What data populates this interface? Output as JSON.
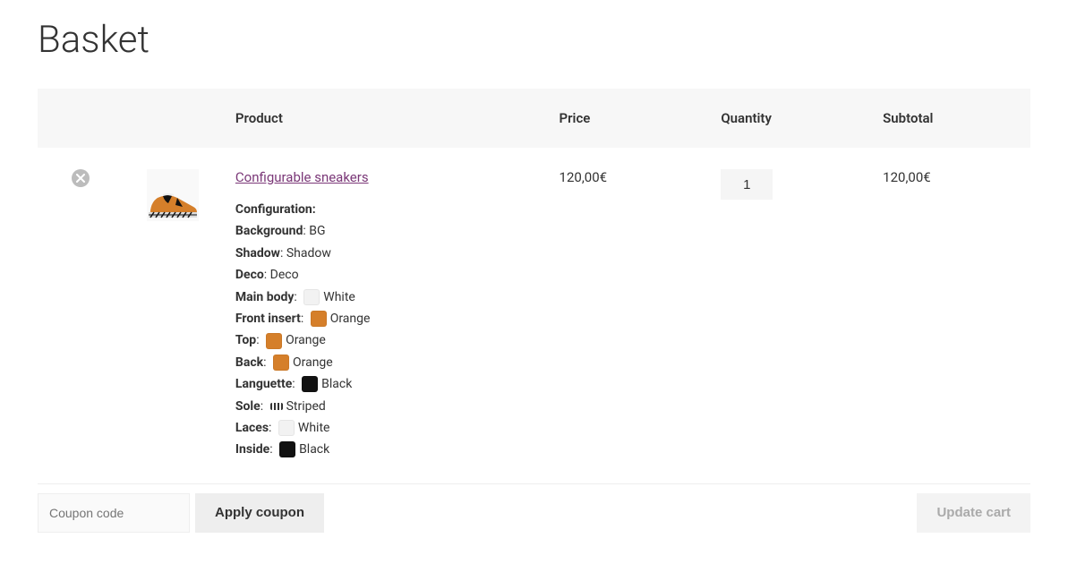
{
  "page_title": "Basket",
  "headers": {
    "product": "Product",
    "price": "Price",
    "quantity": "Quantity",
    "subtotal": "Subtotal"
  },
  "item": {
    "name": "Configurable sneakers",
    "price": "120,00€",
    "quantity": "1",
    "subtotal": "120,00€",
    "config_title": "Configuration:",
    "config": {
      "background": {
        "label": "Background",
        "value": "BG"
      },
      "shadow": {
        "label": "Shadow",
        "value": "Shadow"
      },
      "deco": {
        "label": "Deco",
        "value": "Deco"
      },
      "main_body": {
        "label": "Main body",
        "value": "White",
        "swatch": "white"
      },
      "front_insert": {
        "label": "Front insert",
        "value": "Orange",
        "swatch": "orange"
      },
      "top": {
        "label": "Top",
        "value": "Orange",
        "swatch": "orange"
      },
      "back": {
        "label": "Back",
        "value": "Orange",
        "swatch": "orange"
      },
      "languette": {
        "label": "Languette",
        "value": "Black",
        "swatch": "black"
      },
      "sole": {
        "label": "Sole",
        "value": "Striped",
        "swatch": "striped"
      },
      "laces": {
        "label": "Laces",
        "value": "White",
        "swatch": "white"
      },
      "inside": {
        "label": "Inside",
        "value": "Black",
        "swatch": "black"
      }
    }
  },
  "coupon": {
    "placeholder": "Coupon code",
    "apply_label": "Apply coupon"
  },
  "update_label": "Update cart"
}
